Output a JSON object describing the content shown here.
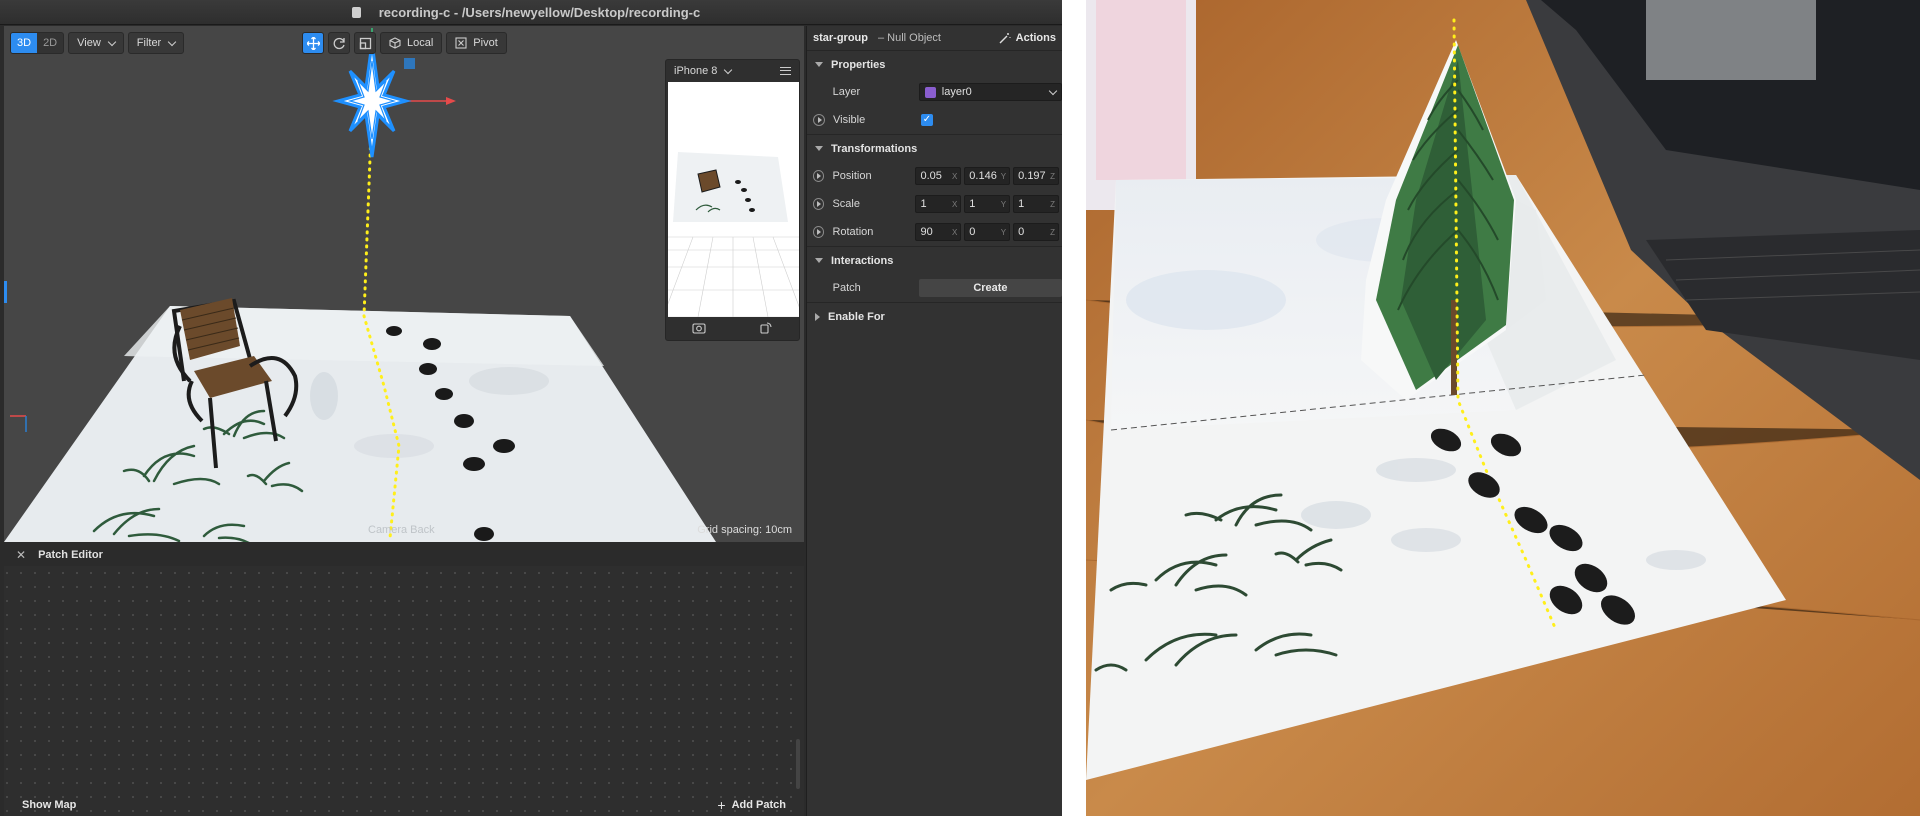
{
  "window": {
    "title": "recording-c - /Users/newyellow/Desktop/recording-c"
  },
  "toolbar": {
    "mode_3d": "3D",
    "mode_2d": "2D",
    "view_label": "View",
    "filter_label": "Filter",
    "local_label": "Local",
    "pivot_label": "Pivot"
  },
  "viewport": {
    "camera_label": "Camera Back",
    "grid_spacing": "Grid spacing: 10cm"
  },
  "simulator": {
    "device": "iPhone 8"
  },
  "patch_editor": {
    "title": "Patch Editor",
    "show_map": "Show Map",
    "add_patch": "Add Patch"
  },
  "inspector": {
    "object_name": "star-group",
    "object_type": "– Null Object",
    "actions_label": "Actions",
    "properties_label": "Properties",
    "layer_label": "Layer",
    "layer_value": "layer0",
    "layer_color": "#8a5ecf",
    "visible_label": "Visible",
    "visible_checked": true,
    "transformations_label": "Transformations",
    "position_label": "Position",
    "position": [
      "0.05",
      "0.146",
      "0.197"
    ],
    "scale_label": "Scale",
    "scale": [
      "1",
      "1",
      "1"
    ],
    "rotation_label": "Rotation",
    "rotation": [
      "90",
      "0",
      "0"
    ],
    "axes": [
      "X",
      "Y",
      "Z"
    ],
    "interactions_label": "Interactions",
    "patch_label": "Patch",
    "create_label": "Create",
    "enable_for_label": "Enable For"
  },
  "colors": {
    "accent": "#2d8cf0",
    "dotted_line": "#ffef1a"
  }
}
